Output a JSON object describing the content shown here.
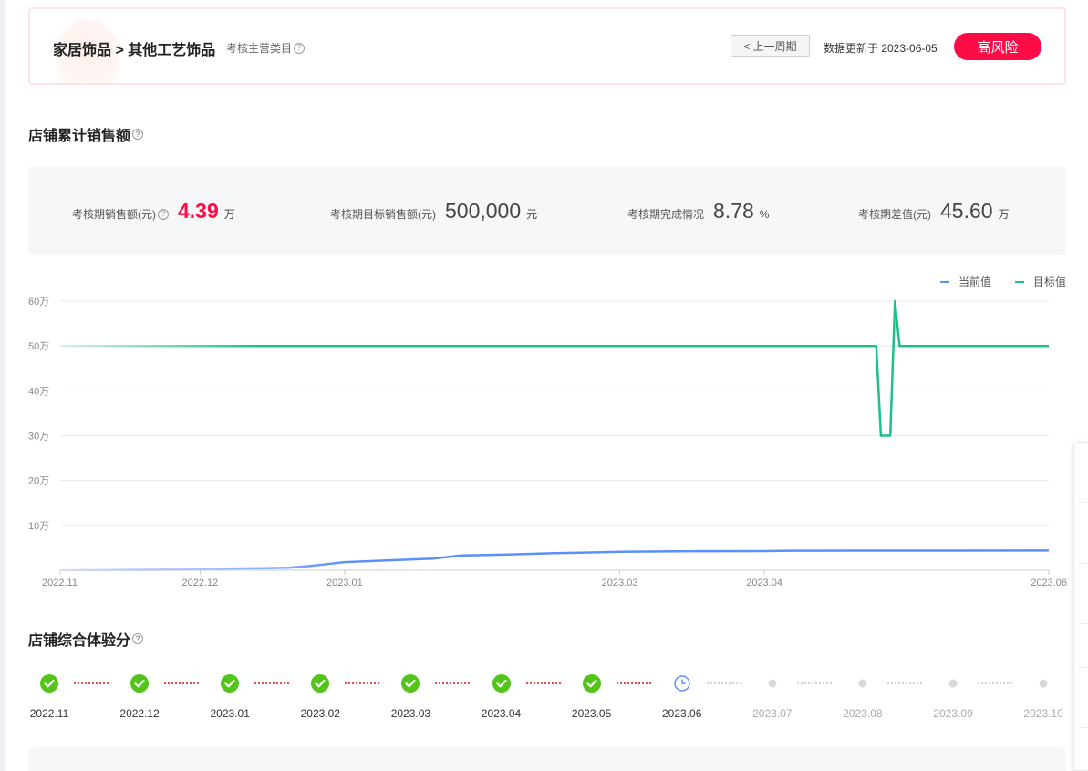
{
  "header": {
    "category_title": "家居饰品 > 其他工艺饰品",
    "category_sub": "考核主营类目",
    "prev_button": "< 上一周期",
    "update_text": "数据更新于 2023-06-05",
    "risk_badge": "高风险"
  },
  "sales_section": {
    "title": "店铺累计销售额",
    "stats": [
      {
        "label": "考核期销售额(元)",
        "value": "4.39",
        "unit": "万",
        "has_help": true
      },
      {
        "label": "考核期目标销售额(元)",
        "value": "500,000",
        "unit": "元",
        "has_help": false
      },
      {
        "label": "考核期完成情况",
        "value": "8.78",
        "unit": "%",
        "has_help": false
      },
      {
        "label": "考核期差值(元)",
        "value": "45.60",
        "unit": "万",
        "has_help": false
      }
    ]
  },
  "chart_data": {
    "type": "line",
    "x_ticks": [
      "2022.11",
      "2022.12",
      "2023.01",
      "2023.03",
      "2023.04",
      "2023.06"
    ],
    "y_ticks": [
      "10万",
      "20万",
      "30万",
      "40万",
      "50万",
      "60万"
    ],
    "ylim": [
      0,
      600000
    ],
    "series": [
      {
        "name": "当前值",
        "color": "#5b8ff9",
        "points": [
          [
            "2022-11-01",
            0
          ],
          [
            "2022-11-20",
            1500
          ],
          [
            "2022-12-01",
            3000
          ],
          [
            "2022-12-15",
            4500
          ],
          [
            "2022-12-20",
            5500
          ],
          [
            "2022-12-25",
            10000
          ],
          [
            "2023-01-01",
            18000
          ],
          [
            "2023-01-10",
            22000
          ],
          [
            "2023-01-20",
            26000
          ],
          [
            "2023-01-26",
            33000
          ],
          [
            "2023-02-05",
            35000
          ],
          [
            "2023-02-15",
            38000
          ],
          [
            "2023-02-25",
            40000
          ],
          [
            "2023-03-01",
            41000
          ],
          [
            "2023-03-10",
            42000
          ],
          [
            "2023-03-20",
            42500
          ],
          [
            "2023-04-01",
            42800
          ],
          [
            "2023-04-06",
            43500
          ],
          [
            "2023-04-20",
            43700
          ],
          [
            "2023-05-10",
            43800
          ],
          [
            "2023-06-01",
            43900
          ]
        ]
      },
      {
        "name": "目标值",
        "color": "#1ac18d",
        "points": [
          [
            "2022-11-01",
            500000
          ],
          [
            "2023-04-25",
            500000
          ],
          [
            "2023-04-26",
            300000
          ],
          [
            "2023-04-28",
            300000
          ],
          [
            "2023-04-29",
            600000
          ],
          [
            "2023-04-30",
            500000
          ],
          [
            "2023-06-01",
            500000
          ]
        ]
      }
    ],
    "legend_position": "top-right",
    "grid": true
  },
  "experience_section": {
    "title": "店铺综合体验分",
    "timeline": [
      {
        "month": "2022.11",
        "status": "done"
      },
      {
        "month": "2022.12",
        "status": "done"
      },
      {
        "month": "2023.01",
        "status": "done"
      },
      {
        "month": "2023.02",
        "status": "done"
      },
      {
        "month": "2023.03",
        "status": "done"
      },
      {
        "month": "2023.04",
        "status": "done"
      },
      {
        "month": "2023.05",
        "status": "done"
      },
      {
        "month": "2023.06",
        "status": "current"
      },
      {
        "month": "2023.07",
        "status": "future"
      },
      {
        "month": "2023.08",
        "status": "future"
      },
      {
        "month": "2023.09",
        "status": "future"
      },
      {
        "month": "2023.10",
        "status": "future"
      }
    ]
  },
  "colors": {
    "risk": "#ff0c46",
    "done": "#52c41a",
    "current": "#5b8ff9",
    "future": "#cccccc",
    "dots_active": "#e84c4c"
  }
}
